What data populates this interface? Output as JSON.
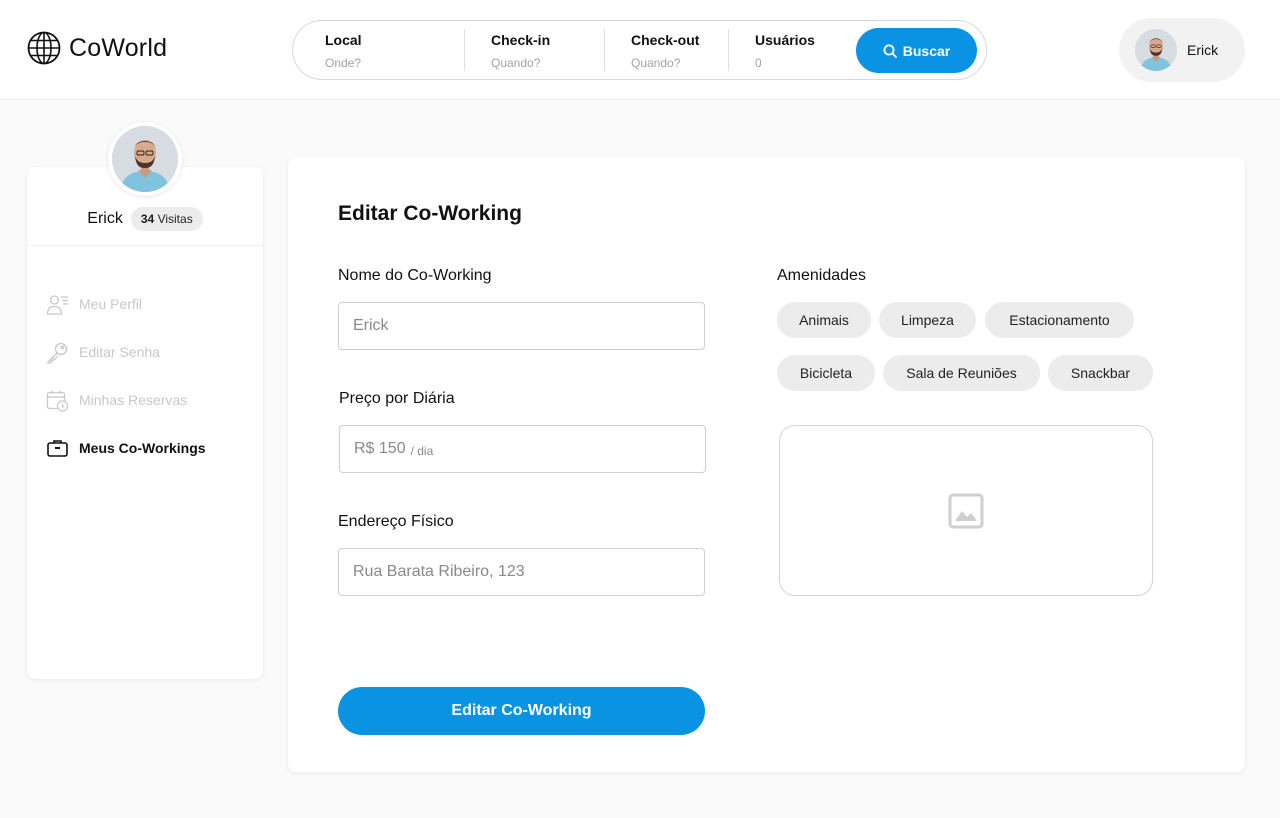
{
  "app": {
    "name": "CoWorld"
  },
  "search": {
    "fields": [
      {
        "label": "Local",
        "placeholder": "Onde?"
      },
      {
        "label": "Check-in",
        "placeholder": "Quando?"
      },
      {
        "label": "Check-out",
        "placeholder": "Quando?"
      },
      {
        "label": "Usuários",
        "placeholder": "0"
      }
    ],
    "button_label": "Buscar"
  },
  "user": {
    "name": "Erick",
    "visits_count": "34",
    "visits_label": "Visitas"
  },
  "sidebar": {
    "items": [
      {
        "label": "Meu Perfil",
        "icon": "user-list-icon",
        "active": false
      },
      {
        "label": "Editar Senha",
        "icon": "key-icon",
        "active": false
      },
      {
        "label": "Minhas Reservas",
        "icon": "calendar-clock-icon",
        "active": false
      },
      {
        "label": "Meus Co-Workings",
        "icon": "briefcase-icon",
        "active": true
      }
    ]
  },
  "form": {
    "title": "Editar Co-Working",
    "name_label": "Nome do Co-Working",
    "name_value": "Erick",
    "price_label": "Preço por Diária",
    "price_value": "R$ 150",
    "price_suffix": "/ dia",
    "address_label": "Endereço Físico",
    "address_value": "Rua Barata Ribeiro, 123",
    "amenities_label": "Amenidades",
    "amenities": [
      "Animais",
      "Limpeza",
      "Estacionamento",
      "Bicicleta",
      "Sala de Reuniões",
      "Snackbar"
    ],
    "submit_label": "Editar Co-Working"
  },
  "colors": {
    "primary": "#0a93e3",
    "chip_bg": "#ececec",
    "muted_text": "#c8c8c8"
  }
}
